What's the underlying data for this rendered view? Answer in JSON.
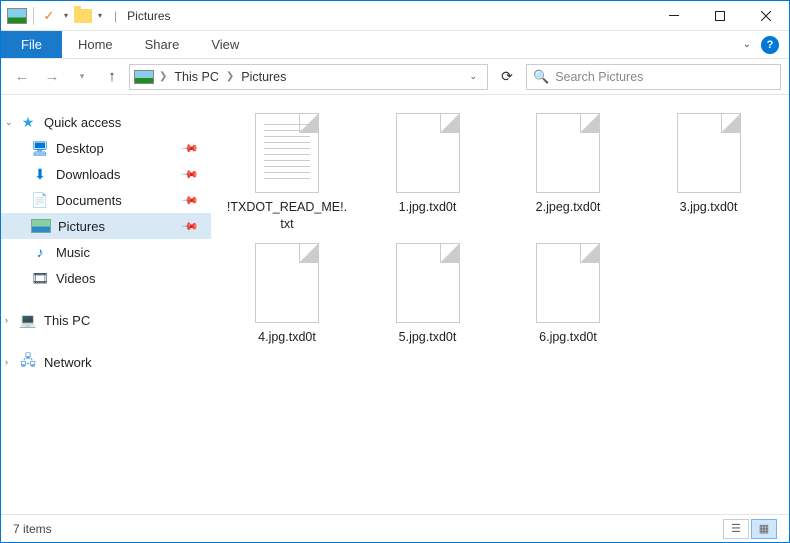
{
  "title": "Pictures",
  "ribbon": {
    "file": "File",
    "tabs": [
      "Home",
      "Share",
      "View"
    ]
  },
  "breadcrumb": {
    "segments": [
      "This PC",
      "Pictures"
    ]
  },
  "search": {
    "placeholder": "Search Pictures"
  },
  "sidebar": {
    "quick_access": "Quick access",
    "items": [
      {
        "label": "Desktop",
        "pinned": true
      },
      {
        "label": "Downloads",
        "pinned": true
      },
      {
        "label": "Documents",
        "pinned": true
      },
      {
        "label": "Pictures",
        "pinned": true,
        "selected": true
      },
      {
        "label": "Music",
        "pinned": false
      },
      {
        "label": "Videos",
        "pinned": false
      }
    ],
    "this_pc": "This PC",
    "network": "Network"
  },
  "files": [
    {
      "name": "!TXDOT_READ_ME!.txt",
      "type": "txt"
    },
    {
      "name": "1.jpg.txd0t",
      "type": "blank"
    },
    {
      "name": "2.jpeg.txd0t",
      "type": "blank"
    },
    {
      "name": "3.jpg.txd0t",
      "type": "blank"
    },
    {
      "name": "4.jpg.txd0t",
      "type": "blank"
    },
    {
      "name": "5.jpg.txd0t",
      "type": "blank"
    },
    {
      "name": "6.jpg.txd0t",
      "type": "blank"
    }
  ],
  "status": {
    "count_text": "7 items"
  }
}
